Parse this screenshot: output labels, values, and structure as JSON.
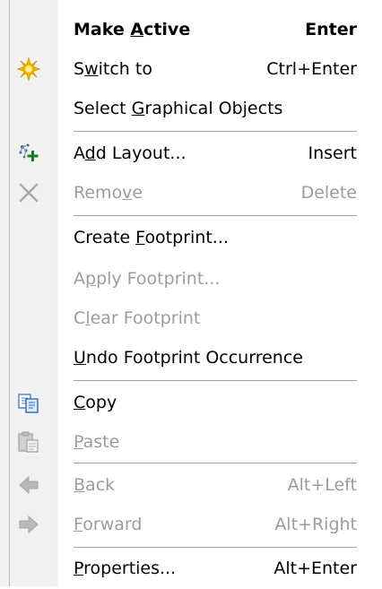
{
  "menu": {
    "items": [
      {
        "label_pre": "Make ",
        "label_key": "A",
        "label_post": "ctive",
        "shortcut": "Enter",
        "icon": "none"
      },
      {
        "label_pre": "S",
        "label_key": "w",
        "label_post": "itch to",
        "shortcut": "Ctrl+Enter",
        "icon": "sun-icon"
      },
      {
        "label_pre": "Select ",
        "label_key": "G",
        "label_post": "raphical Objects",
        "shortcut": "",
        "icon": "none"
      },
      {
        "label_pre": "A",
        "label_key": "d",
        "label_post": "d Layout...",
        "shortcut": "Insert",
        "icon": "add-layout-icon"
      },
      {
        "label_pre": "Remo",
        "label_key": "v",
        "label_post": "e",
        "shortcut": "Delete",
        "icon": "remove-x-icon"
      },
      {
        "label_pre": "Create ",
        "label_key": "F",
        "label_post": "ootprint...",
        "shortcut": "",
        "icon": "none"
      },
      {
        "label_pre": "A",
        "label_key": "p",
        "label_post": "ply Footprint...",
        "shortcut": "",
        "icon": "none"
      },
      {
        "label_pre": "C",
        "label_key": "l",
        "label_post": "ear Footprint",
        "shortcut": "",
        "icon": "none"
      },
      {
        "label_pre": "",
        "label_key": "U",
        "label_post": "ndo Footprint Occurrence",
        "shortcut": "",
        "icon": "none"
      },
      {
        "label_pre": "",
        "label_key": "C",
        "label_post": "opy",
        "shortcut": "",
        "icon": "copy-icon"
      },
      {
        "label_pre": "",
        "label_key": "P",
        "label_post": "aste",
        "shortcut": "",
        "icon": "paste-icon"
      },
      {
        "label_pre": "",
        "label_key": "B",
        "label_post": "ack",
        "shortcut": "Alt+Left",
        "icon": "back-arrow-icon"
      },
      {
        "label_pre": "",
        "label_key": "F",
        "label_post": "orward",
        "shortcut": "Alt+Right",
        "icon": "forward-arrow-icon"
      },
      {
        "label_pre": "",
        "label_key": "P",
        "label_post": "roperties...",
        "shortcut": "Alt+Enter",
        "icon": "none"
      }
    ]
  },
  "colors": {
    "enabled_text": "#000000",
    "disabled_text": "#9c9c9c",
    "separator": "#a0a0a0",
    "gutter": "#f1f1f1"
  }
}
